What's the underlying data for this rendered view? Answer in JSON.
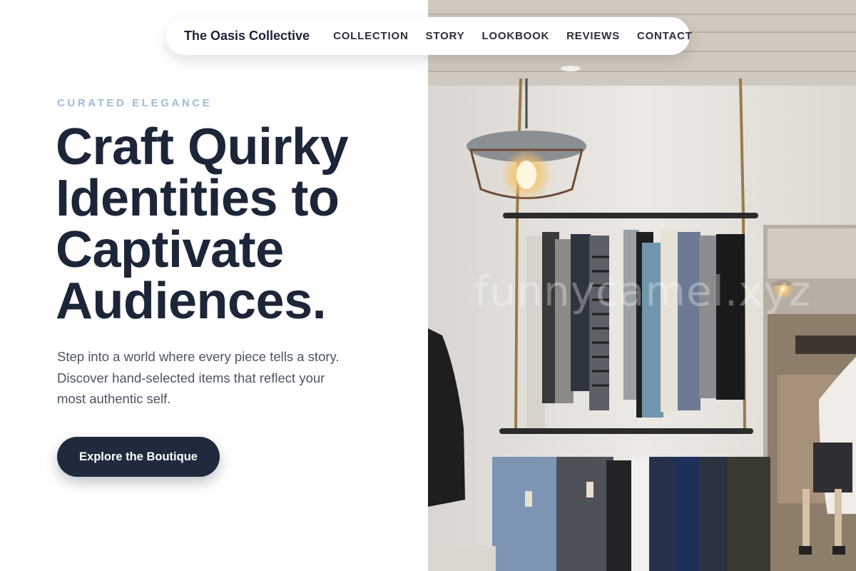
{
  "brand": "The Oasis Collective",
  "nav": {
    "links": [
      "COLLECTION",
      "STORY",
      "LOOKBOOK",
      "REVIEWS",
      "CONTACT"
    ]
  },
  "hero": {
    "eyebrow": "CURATED ELEGANCE",
    "headline_lines": [
      "Craft Quirky",
      "Identities to",
      "Captivate",
      "Audiences."
    ],
    "subtext_lines": [
      "Step into a world where every piece tells a story.",
      "Discover hand-selected items that reflect your",
      "most authentic self."
    ],
    "cta_label": "Explore the Boutique"
  },
  "image": {
    "subject": "boutique-clothing-rack-photo",
    "watermark": "funnycamel.xyz"
  },
  "colors": {
    "navy": "#1c2638",
    "eyebrow": "#9cbcdc",
    "body_text": "#4c5564",
    "button_bg": "#1f2a3d"
  }
}
